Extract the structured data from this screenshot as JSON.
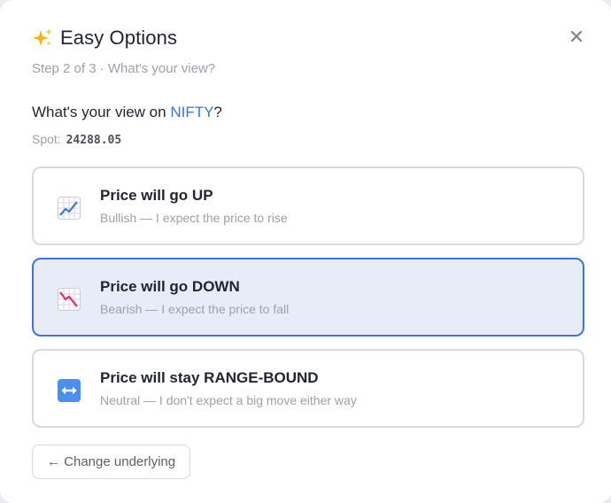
{
  "header": {
    "title": "Easy Options",
    "step": "Step 2 of 3 · What's your view?"
  },
  "question": {
    "prefix": "What's your view on ",
    "symbol": "NIFTY",
    "suffix": "?"
  },
  "spot": {
    "label": "Spot:",
    "value": "24288.05"
  },
  "options": [
    {
      "label": "Price will go UP",
      "description": "Bullish — I expect the price to rise",
      "icon": "chart-increasing-icon",
      "selected": false
    },
    {
      "label": "Price will go DOWN",
      "description": "Bearish — I expect the price to fall",
      "icon": "chart-decreasing-icon",
      "selected": true
    },
    {
      "label": "Price will stay RANGE-BOUND",
      "description": "Neutral — I don't expect a big move either way",
      "icon": "left-right-arrow-icon",
      "selected": false
    }
  ],
  "footer": {
    "back_label": "← Change underlying"
  },
  "colors": {
    "accent": "#3b73e0",
    "selected_bg": "#e8ecf6",
    "muted_text": "#9aa1ad",
    "border": "#d7dbe1"
  }
}
